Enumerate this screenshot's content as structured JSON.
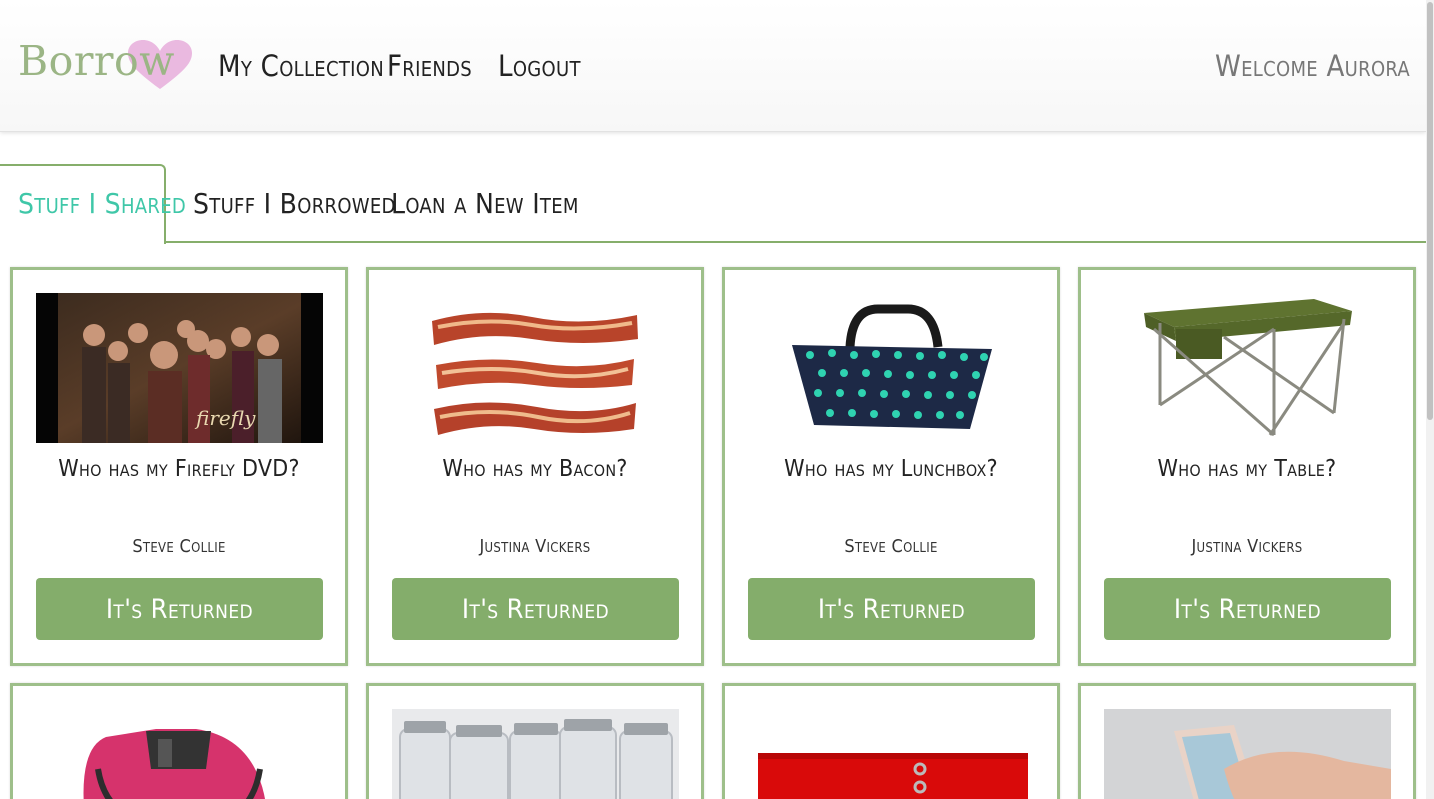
{
  "header": {
    "logo_text": "Borrow",
    "nav": [
      "My Collection",
      "Friends",
      "Logout"
    ],
    "welcome": "Welcome Aurora"
  },
  "tabs": [
    "Stuff I Shared",
    "Stuff I Borrowed",
    "Loan a New Item"
  ],
  "active_tab": "Stuff I Shared",
  "colors": {
    "accent_green": "#84ad6b",
    "active_tab_text": "#3fc7a8",
    "logo_heart": "#e6b3dd",
    "card_border": "#9ebf8a"
  },
  "cards": [
    {
      "title": "Who has my Firefly DVD?",
      "owner": "Steve Collie",
      "button": "It's Returned",
      "image": "firefly-dvd-cover",
      "logo_text": "firefly"
    },
    {
      "title": "Who has my Bacon?",
      "owner": "Justina Vickers",
      "button": "It's Returned",
      "image": "bacon-strips"
    },
    {
      "title": "Who has my Lunchbox?",
      "owner": "Steve Collie",
      "button": "It's Returned",
      "image": "polka-dot-lunch-bag"
    },
    {
      "title": "Who has my Table?",
      "owner": "Justina Vickers",
      "button": "It's Returned",
      "image": "folding-camp-table"
    }
  ],
  "partial_cards": [
    {
      "image": "pink-bottle-carrier"
    },
    {
      "image": "glass-mason-jars"
    },
    {
      "image": "red-binder"
    },
    {
      "image": "phone-in-hand"
    }
  ]
}
